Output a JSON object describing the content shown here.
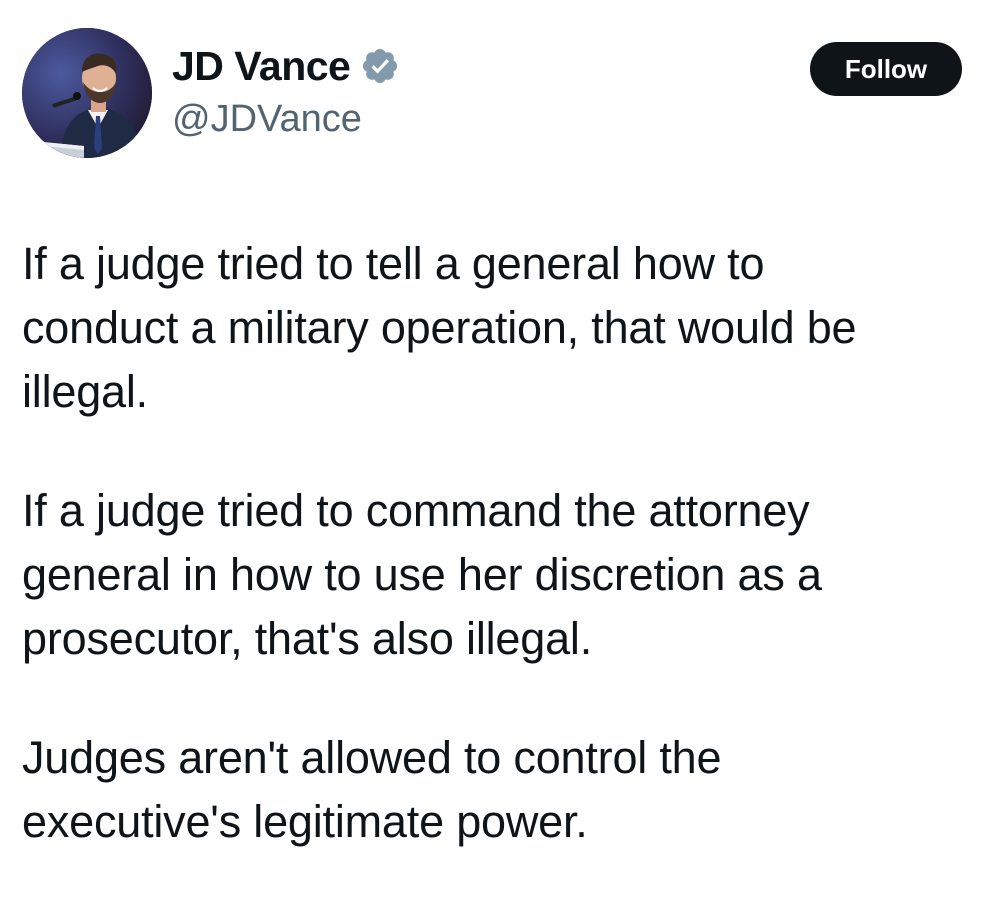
{
  "author": {
    "display_name": "JD Vance",
    "handle": "@JDVance",
    "verified": true,
    "verified_badge_color": "#829aab",
    "avatar_icon": "profile-photo"
  },
  "actions": {
    "follow_label": "Follow"
  },
  "tweet": {
    "paragraphs": [
      "If a judge tried to tell a general how to\nconduct a military operation, that would be\nillegal.",
      "If a judge tried to command the attorney\ngeneral in how to use her discretion as a\nprosecutor, that's also illegal.",
      "Judges aren't allowed to control the\nexecutive's legitimate power."
    ]
  },
  "colors": {
    "text": "#0f1419",
    "secondary_text": "#536471",
    "button_bg": "#0f1419",
    "button_text": "#ffffff"
  }
}
